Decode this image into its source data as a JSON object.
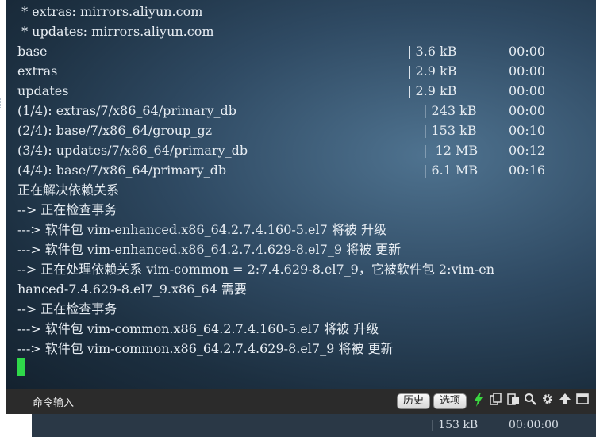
{
  "terminal": {
    "lines": [
      " * extras: mirrors.aliyun.com",
      " * updates: mirrors.aliyun.com",
      "base",
      "extras",
      "updates",
      "(1/4): extras/7/x86_64/primary_db",
      "(2/4): base/7/x86_64/group_gz",
      "(3/4): updates/7/x86_64/primary_db",
      "(4/4): base/7/x86_64/primary_db",
      "正在解决依赖关系",
      "--> 正在检查事务",
      "---> 软件包 vim-enhanced.x86_64.2.7.4.160-5.el7 将被 升级",
      "---> 软件包 vim-enhanced.x86_64.2.7.4.629-8.el7_9 将被 更新",
      "--> 正在处理依赖关系 vim-common = 2:7.4.629-8.el7_9，它被软件包 2:vim-en",
      "hanced-7.4.629-8.el7_9.x86_64 需要",
      "--> 正在检查事务",
      "---> 软件包 vim-common.x86_64.2.7.4.160-5.el7 将被 升级",
      "---> 软件包 vim-common.x86_64.2.7.4.629-8.el7_9 将被 更新"
    ],
    "sizes": [
      "| 3.6 kB",
      "| 2.9 kB",
      "| 2.9 kB",
      "| 243 kB",
      "| 153 kB",
      "|  12 MB",
      "| 6.1 MB"
    ],
    "times": [
      "00:00",
      "00:00",
      "00:00",
      "00:00",
      "00:10",
      "00:12",
      "00:16"
    ]
  },
  "input_bar": {
    "label": "命令输入",
    "history_button": "历史",
    "options_button": "选项"
  },
  "icons": {
    "lightning": "lightning-icon",
    "copy": "copy-icon",
    "paste": "paste-icon",
    "search": "search-icon",
    "settings": "gear-icon",
    "up": "arrow-up-icon",
    "window": "window-icon"
  },
  "bottom": {
    "size": "| 153 kB",
    "time": "00:00:00"
  },
  "colors": {
    "cursor": "#2fd84a",
    "text": "#e6ecf2",
    "bar": "#2b2b2b"
  }
}
